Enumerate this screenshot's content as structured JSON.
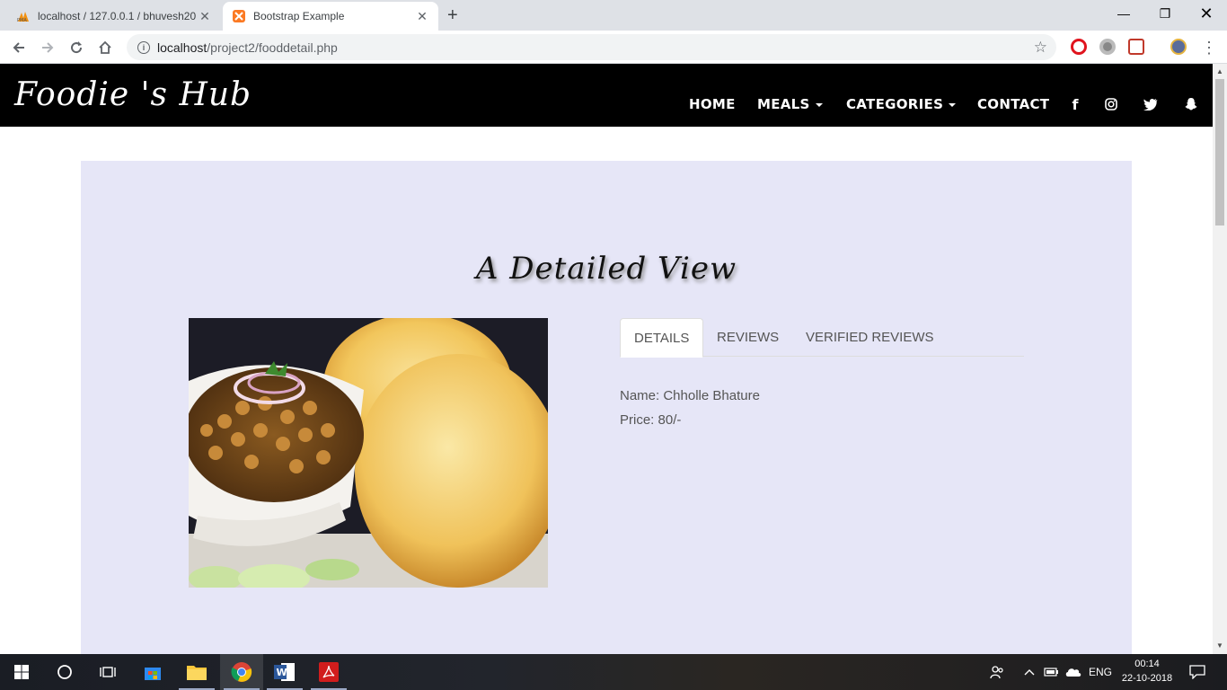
{
  "browser": {
    "tabs": [
      {
        "title": "localhost / 127.0.0.1 / bhuvesh20",
        "active": false
      },
      {
        "title": "Bootstrap Example",
        "active": true
      }
    ],
    "url_host": "localhost",
    "url_path": "/project2/fooddetail.php"
  },
  "site": {
    "logo": "Foodie 's Hub",
    "nav": {
      "home": "HOME",
      "meals": "MEALS",
      "categories": "CATEGORIES",
      "contact": "CONTACT"
    },
    "social": [
      "facebook-icon",
      "instagram-icon",
      "twitter-icon",
      "snapchat-icon"
    ]
  },
  "page": {
    "heading": "A Detailed View",
    "image_alt": "Chholle Bhature",
    "tabs": [
      "DETAILS",
      "REVIEWS",
      "VERIFIED REVIEWS"
    ],
    "active_tab": "DETAILS",
    "details": {
      "name_line": "Name: Chholle Bhature",
      "price_line": "Price: 80/-"
    }
  },
  "taskbar": {
    "language": "ENG",
    "time": "00:14",
    "date": "22-10-2018"
  },
  "colors": {
    "panel_bg": "#e6e6f7",
    "nav_bg": "#000000",
    "tabstrip_bg": "#dee1e6"
  }
}
